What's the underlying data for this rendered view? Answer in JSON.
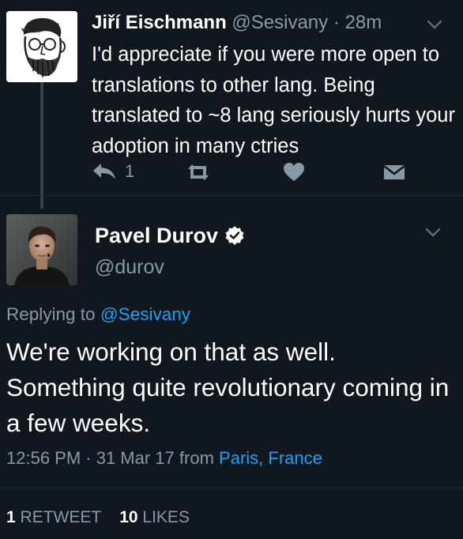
{
  "reply_tweet": {
    "name": "Jiří Eischmann",
    "handle": "@Sesivany",
    "separator": "·",
    "time": "28m",
    "text": "I'd appreciate if you were more open to translations to other lang. Being translated to ~8 lang seriously hurts your adoption in many ctries",
    "reply_count": "1",
    "icons": {
      "reply": "reply-icon",
      "retweet": "retweet-icon",
      "like": "heart-icon",
      "dm": "direct-message-icon",
      "menu": "chevron-down-icon"
    }
  },
  "main_tweet": {
    "name": "Pavel Durov",
    "handle": "@durov",
    "verified_icon": "verified-badge-icon",
    "replying_prefix": "Replying to",
    "replying_mention": "@Sesivany",
    "text": "We're working on that as well. Something quite revolutionary coming in a few weeks.",
    "time": "12:56 PM · 31 Mar 17",
    "from_label": "from",
    "place": "Paris, France",
    "retweets": "1",
    "retweets_label": "Retweet",
    "likes": "10",
    "likes_label": "Likes"
  },
  "colors": {
    "background": "#10171e",
    "secondary_text": "#8899a6",
    "link": "#1da1f2"
  }
}
